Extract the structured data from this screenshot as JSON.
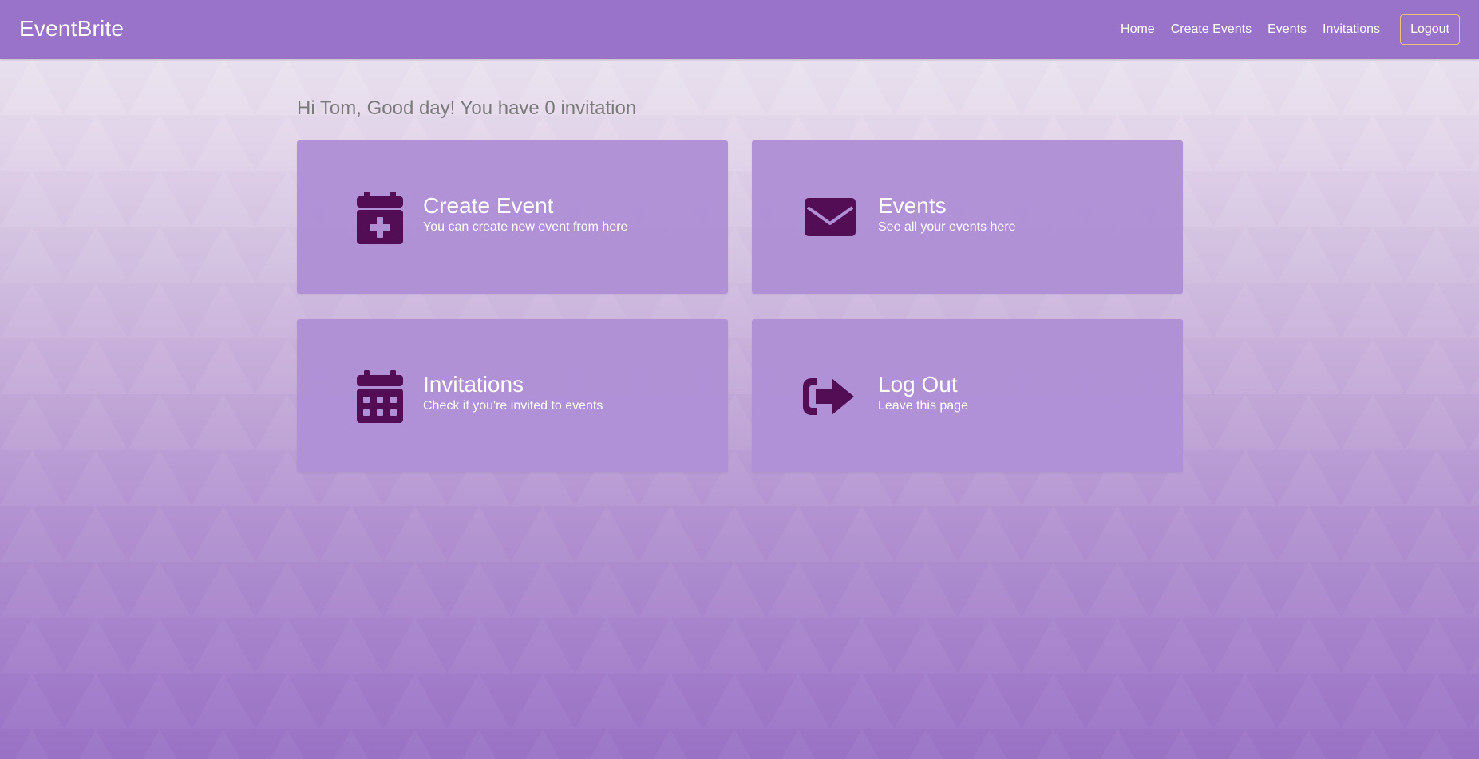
{
  "app": {
    "brand": "EventBrite"
  },
  "nav": {
    "items": [
      {
        "label": "Home"
      },
      {
        "label": "Create Events"
      },
      {
        "label": "Events"
      },
      {
        "label": "Invitations"
      }
    ],
    "logout_label": "Logout"
  },
  "main": {
    "greeting": "Hi Tom, Good day! You have 0 invitation",
    "cards": [
      {
        "title": "Create Event",
        "subtitle": "You can create new event from here",
        "icon": "calendar-plus-icon"
      },
      {
        "title": "Events",
        "subtitle": "See all your events here",
        "icon": "envelope-icon"
      },
      {
        "title": "Invitations",
        "subtitle": "Check if you're invited to events",
        "icon": "calendar-icon"
      },
      {
        "title": "Log Out",
        "subtitle": "Leave this page",
        "icon": "sign-out-icon"
      }
    ]
  },
  "colors": {
    "navbar": "#9873c9",
    "card": "#b08fd6",
    "icon": "#520d55",
    "logout_border": "#f1c27a",
    "greeting_text": "#7a7a7a"
  }
}
